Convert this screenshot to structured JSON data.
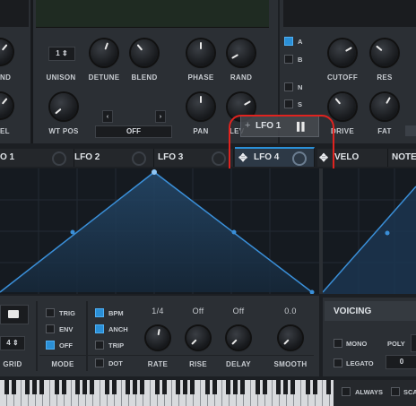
{
  "osc_section": {
    "knob_labels": [
      "UNISON",
      "DETUNE",
      "BLEND",
      "PHASE",
      "RAND",
      "WT POS",
      "PAN",
      "LEV"
    ],
    "left_partial_labels": [
      "ND",
      "EL"
    ],
    "unison_value": "1",
    "wtpos_value": "OFF",
    "nav_left": "‹",
    "nav_right": "›"
  },
  "filter_section": {
    "routing_letters": [
      "A",
      "B",
      "N",
      "S"
    ],
    "knob_labels": [
      "CUTOFF",
      "RES",
      "DRIVE",
      "FAT"
    ]
  },
  "drag_ghost": {
    "label": "LFO 1"
  },
  "mod_tabs": [
    {
      "label": "O 1"
    },
    {
      "label": "LFO 2"
    },
    {
      "label": "LFO 3"
    },
    {
      "label": "LFO 4",
      "highlighted": true
    },
    {
      "label": "VELO"
    },
    {
      "label": "NOTE"
    }
  ],
  "lfo_controls": {
    "grid_value": "4",
    "grid_label": "GRID",
    "mode_options": [
      "TRIG",
      "ENV",
      "OFF"
    ],
    "mode_label": "MODE",
    "mode_checked": "OFF",
    "flags": [
      {
        "label": "BPM",
        "checked": true
      },
      {
        "label": "ANCH",
        "checked": true
      },
      {
        "label": "TRIP",
        "checked": false
      },
      {
        "label": "DOT",
        "checked": false
      }
    ],
    "knobs": [
      {
        "label": "RATE",
        "value": "1/4"
      },
      {
        "label": "RISE",
        "value": "Off"
      },
      {
        "label": "DELAY",
        "value": "Off"
      },
      {
        "label": "SMOOTH",
        "value": "0.0"
      }
    ]
  },
  "voicing": {
    "title": "VOICING",
    "mono_label": "MONO",
    "poly_label": "POLY",
    "legato_label": "LEGATO",
    "legato_value": "0",
    "always_label": "ALWAYS",
    "scale_partial": "SCA"
  },
  "colors": {
    "accent": "#2a8fd6",
    "highlight_ring": "#e0231f",
    "lfo_line": "#3a8fd8"
  }
}
